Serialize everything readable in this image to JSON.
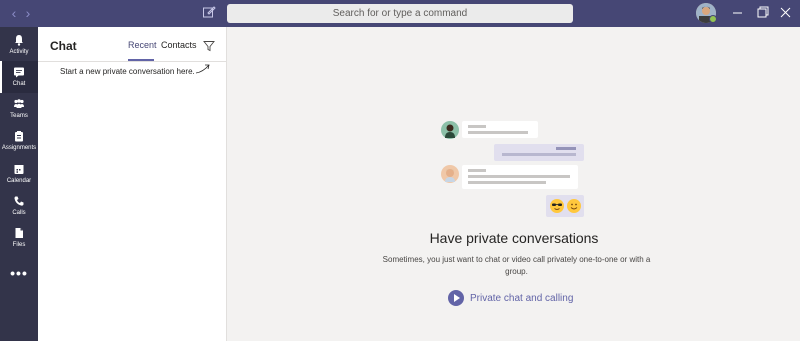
{
  "titlebar": {
    "search_placeholder": "Search for or type a command"
  },
  "appbar": {
    "items": [
      {
        "label": "Activity",
        "icon": "bell-icon"
      },
      {
        "label": "Chat",
        "icon": "chat-icon"
      },
      {
        "label": "Teams",
        "icon": "teams-icon"
      },
      {
        "label": "Assignments",
        "icon": "assignments-icon"
      },
      {
        "label": "Calendar",
        "icon": "calendar-icon"
      },
      {
        "label": "Calls",
        "icon": "phone-icon"
      },
      {
        "label": "Files",
        "icon": "file-icon"
      }
    ],
    "active": "Chat",
    "more": "•••"
  },
  "chatpane": {
    "title": "Chat",
    "tabs": [
      "Recent",
      "Contacts"
    ],
    "active_tab": "Recent",
    "hint": "Start a new private conversation here."
  },
  "main": {
    "heading": "Have private conversations",
    "description": "Sometimes, you just want to chat or video call privately one-to-one or with a group.",
    "cta": "Private chat and calling"
  },
  "colors": {
    "titlebar": "#464775",
    "appbar": "#33344a",
    "accent": "#6264a7",
    "background": "#f3f2f1"
  }
}
